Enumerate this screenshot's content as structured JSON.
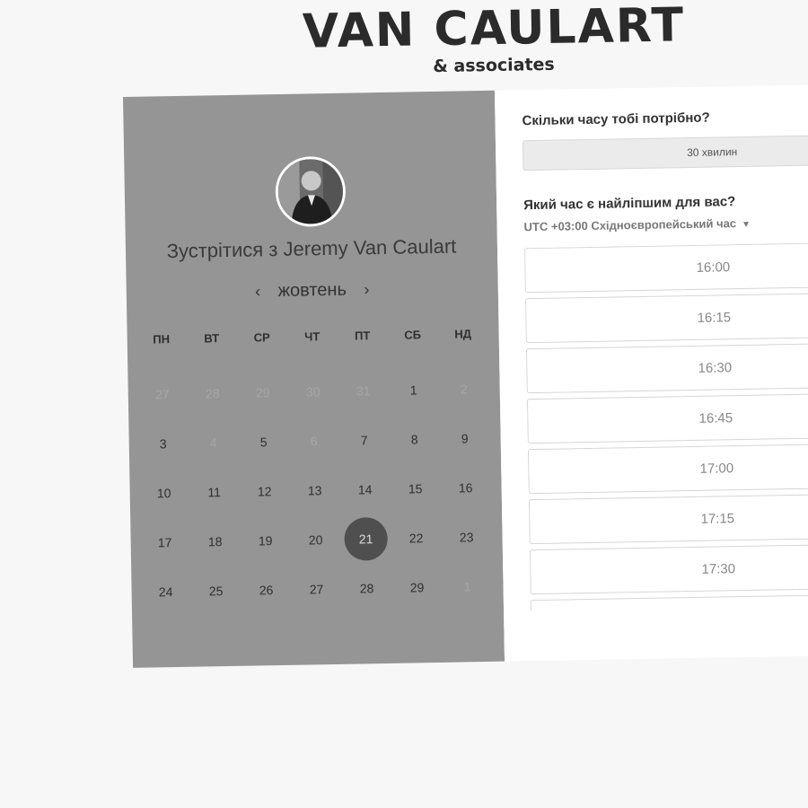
{
  "brand": {
    "title": "VAN CAULART",
    "subtitle": "& associates"
  },
  "calendar": {
    "meet_prefix": "Зустрітися з ",
    "host_name": "Jeremy Van Caulart",
    "month": "жовтень",
    "prev_arrow": "‹",
    "next_arrow": "›",
    "weekdays": [
      "ПН",
      "ВТ",
      "СР",
      "ЧТ",
      "ПТ",
      "СБ",
      "НД"
    ],
    "weeks": [
      [
        {
          "d": "27",
          "m": true
        },
        {
          "d": "28",
          "m": true
        },
        {
          "d": "29",
          "m": true
        },
        {
          "d": "30",
          "m": true
        },
        {
          "d": "31",
          "m": true
        },
        {
          "d": "1",
          "m": false
        },
        {
          "d": "2",
          "m": true
        }
      ],
      [
        {
          "d": "3",
          "m": false
        },
        {
          "d": "4",
          "m": true
        },
        {
          "d": "5",
          "m": false
        },
        {
          "d": "6",
          "m": true
        },
        {
          "d": "7",
          "m": false
        },
        {
          "d": "8",
          "m": false
        },
        {
          "d": "9",
          "m": false
        }
      ],
      [
        {
          "d": "10",
          "m": false
        },
        {
          "d": "11",
          "m": false
        },
        {
          "d": "12",
          "m": false
        },
        {
          "d": "13",
          "m": false
        },
        {
          "d": "14",
          "m": false
        },
        {
          "d": "15",
          "m": false
        },
        {
          "d": "16",
          "m": false
        }
      ],
      [
        {
          "d": "17",
          "m": false
        },
        {
          "d": "18",
          "m": false
        },
        {
          "d": "19",
          "m": false
        },
        {
          "d": "20",
          "m": false
        },
        {
          "d": "21",
          "m": false,
          "selected": true
        },
        {
          "d": "22",
          "m": false
        },
        {
          "d": "23",
          "m": false
        }
      ],
      [
        {
          "d": "24",
          "m": false
        },
        {
          "d": "25",
          "m": false
        },
        {
          "d": "26",
          "m": false
        },
        {
          "d": "27",
          "m": false
        },
        {
          "d": "28",
          "m": false
        },
        {
          "d": "29",
          "m": false
        },
        {
          "d": "1",
          "m": true
        }
      ]
    ]
  },
  "booking": {
    "duration_question": "Скільки часу тобі потрібно?",
    "duration_value": "30 хвилин",
    "time_question": "Який час є найліпшим для вас?",
    "timezone": "UTC +03:00 Східноєвропейський час",
    "slots": [
      "16:00",
      "16:15",
      "16:30",
      "16:45",
      "17:00",
      "17:15",
      "17:30",
      ""
    ]
  },
  "icons": {
    "avatar": "host-avatar",
    "dropdown": "caret-down-icon"
  }
}
